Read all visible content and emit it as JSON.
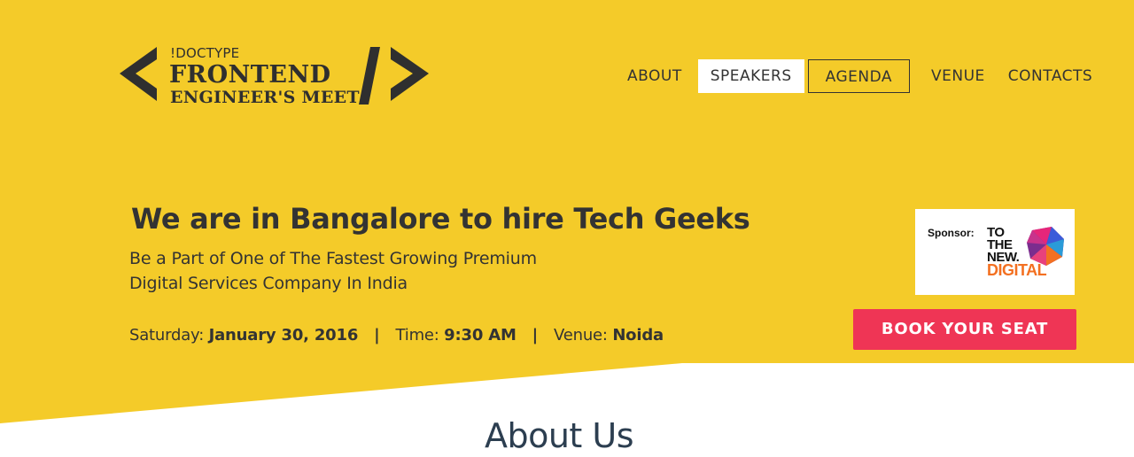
{
  "colors": {
    "hero_bg": "#f4cb29",
    "text": "#333333",
    "cta": "#ef3555",
    "sponsor_accent": "#f37021"
  },
  "logo": {
    "doctype": "!DOCTYPE",
    "line1": "FRONTEND",
    "line2": "ENGINEER'S MEET"
  },
  "nav": {
    "items": [
      {
        "label": "ABOUT"
      },
      {
        "label": "SPEAKERS"
      },
      {
        "label": "AGENDA"
      },
      {
        "label": "VENUE"
      },
      {
        "label": "CONTACTS"
      }
    ]
  },
  "hero": {
    "headline_prefix": "We are in ",
    "headline_bold": "Bangalore to hire Tech Geeks",
    "subtitle": "Be a Part of One of The Fastest Growing Premium Digital Services Company In India",
    "date_label": "Saturday: ",
    "date_value": "January 30, 2016",
    "separator": "|",
    "time_label": "Time: ",
    "time_value": "9:30 AM",
    "venue_label": "Venue: ",
    "venue_value": "Noida"
  },
  "sponsor": {
    "label": "Sponsor:",
    "logo_line1": "TO",
    "logo_line2": "THE",
    "logo_line3": "NEW.",
    "logo_line4": "DIGITAL"
  },
  "cta": {
    "label": "BOOK YOUR SEAT"
  },
  "about": {
    "heading": "About Us"
  }
}
